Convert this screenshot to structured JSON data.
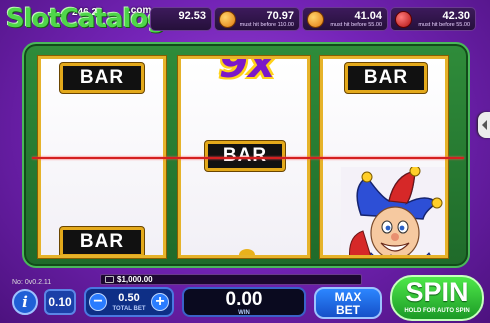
{
  "topbar": {
    "watermark": "SlotCatalog",
    "watermark_url": ".com",
    "jackpot_main": "246.24",
    "jackpots": [
      {
        "icon": "blank-icon",
        "value": "92.53",
        "subtitle": ""
      },
      {
        "icon": "orange-coin-icon",
        "value": "70.97",
        "subtitle": "must hit before 110.00"
      },
      {
        "icon": "orange-coin-icon",
        "value": "41.04",
        "subtitle": "must hit before 55.00"
      },
      {
        "icon": "red-coin-icon",
        "value": "42.30",
        "subtitle": "must hit before 55.00"
      }
    ]
  },
  "reels": {
    "reel1": {
      "top": "BAR",
      "bottom": "BAR"
    },
    "reel2": {
      "top": "9x",
      "middle": "BAR"
    },
    "reel3": {
      "top": "BAR",
      "bottom": "jester-icon"
    }
  },
  "controls": {
    "version": "No: 0v0.2.11",
    "balance": "$1,000.00",
    "info": "i",
    "coin_value": "0.10",
    "bet_minus": "−",
    "bet_plus": "+",
    "total_bet": "0.50",
    "total_bet_label": "TOTAL BET",
    "win": "0.00",
    "win_label": "WIN",
    "max_bet_line1": "MAX",
    "max_bet_line2": "BET",
    "spin": "SPIN",
    "spin_sub": "HOLD FOR AUTO SPIN"
  },
  "colors": {
    "background": "#7524b8",
    "frame_green": "#2f8c3a",
    "reel_gold": "#e6b32a",
    "payline_red": "#d42020",
    "spin_green": "#1c9a26",
    "button_blue": "#1f5fd6"
  }
}
